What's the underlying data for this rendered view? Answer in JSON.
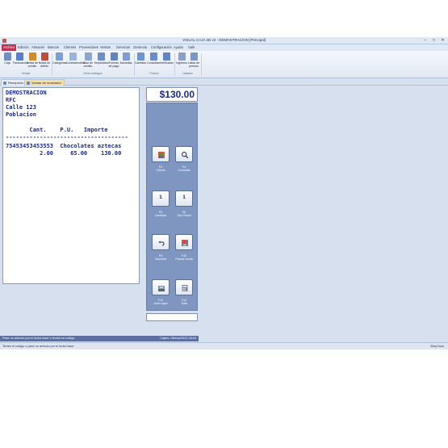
{
  "window": {
    "title": "VISUAL CAJA 3D v2 - DEMOSTRACION [Principal]"
  },
  "menu": {
    "tabs": [
      "Archivo",
      "Edición",
      "Almacén",
      "Bancos",
      "Clientes",
      "Proveedores",
      "Ventas",
      "Servicios",
      "Gerencia",
      "Configuración",
      "Ayuda",
      "Salir"
    ]
  },
  "ribbon": {
    "buttons": [
      {
        "label": "Caja",
        "icon": "cash-register-icon",
        "color": "#6f8fc6"
      },
      {
        "label": "Facturación",
        "icon": "invoice-icon",
        "color": "#5b7fc2"
      },
      {
        "label": "Notas de crédito",
        "icon": "credit-note-icon",
        "color": "#d28b2f"
      },
      {
        "label": "Notas de débito",
        "icon": "debit-note-icon",
        "color": "#c44b3a"
      },
      {
        "label": "Categorías",
        "icon": "categories-icon",
        "color": "#7a9fd6"
      },
      {
        "label": "Contrarrecibos",
        "icon": "receipts-icon",
        "color": "#9bb3dc"
      },
      {
        "label": "Días de crédito",
        "icon": "calendar-icon",
        "color": "#8aa6d4"
      },
      {
        "label": "Empleados",
        "icon": "employees-icon",
        "color": "#6c8fc8"
      },
      {
        "label": "Formas de pago",
        "icon": "payment-icon",
        "color": "#5e84c1"
      },
      {
        "label": "Monedas",
        "icon": "coins-icon",
        "color": "#7f9dd0"
      },
      {
        "label": "Cambios",
        "icon": "price-change-icon",
        "color": "#7095cc"
      },
      {
        "label": "Consultas",
        "icon": "price-query-icon",
        "color": "#6a8dc6"
      },
      {
        "label": "Verificador",
        "icon": "price-checker-icon",
        "color": "#5f86c2"
      },
      {
        "label": "Ingresos",
        "icon": "income-report-icon",
        "color": "#8aa0c8"
      },
      {
        "label": "Listas de precios",
        "icon": "price-list-icon",
        "color": "#7d95c2"
      }
    ],
    "groups": [
      "Ventas",
      "Otros catálogos",
      "Precios",
      "Listados"
    ]
  },
  "doctabs": [
    "Recepción",
    "Ventas de mostrador"
  ],
  "receipt": {
    "lines": [
      "DEMOSTRACION",
      "RFC",
      "Calle 123",
      "Poblacion",
      "       Cant.    P.U.   Importe",
      "------------------------------------",
      "75453453453553  Chocolates aztecas",
      "          2.00     65.00    130.00"
    ]
  },
  "pos": {
    "total": "$130.00",
    "keys": [
      {
        "key": "F2",
        "label": "Cliente",
        "icon": "customer-icon",
        "text": ""
      },
      {
        "key": "F4",
        "label": "Consultar",
        "icon": "search-icon",
        "text": ""
      },
      {
        "key": "F5",
        "label": "Cantidad",
        "icon": "",
        "text": "1"
      },
      {
        "key": "F6",
        "label": "Tipo Precio",
        "icon": "",
        "text": "1"
      },
      {
        "key": "F8",
        "label": "Cancelar",
        "icon": "undo-icon",
        "text": ""
      },
      {
        "key": "F10",
        "label": "Pausar venta",
        "icon": "pause-sale-icon",
        "text": ""
      },
      {
        "key": "F11",
        "label": "Abrir cajón",
        "icon": "cash-drawer-icon",
        "text": ""
      },
      {
        "key": "F12",
        "label": "Total",
        "icon": "total-icon",
        "text": ""
      }
    ]
  },
  "status": {
    "message": "Pase un artículo por el lector laser o teclee un codigo",
    "datetime": "Cajero, 06/sep/2012 18:16",
    "hint": "Teclee el código o pase un artículo por el lector laser",
    "numlock": "Bloq Num"
  },
  "colors": {
    "active_tab": "#c0304f",
    "receipt_text": "#1b2b8a",
    "keypad_bg": "#7f96c0",
    "message_bar": "#5c6fa0"
  }
}
